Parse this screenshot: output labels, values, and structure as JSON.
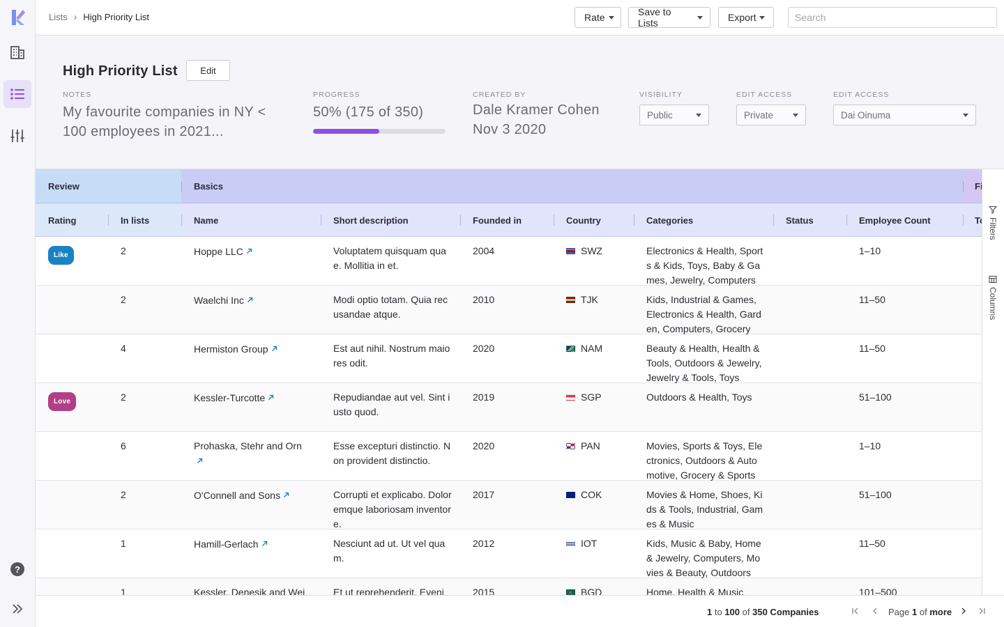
{
  "breadcrumb": {
    "parent": "Lists",
    "current": "High Priority List"
  },
  "toolbar": {
    "rate": "Rate",
    "save_to_lists": "Save to Lists",
    "export": "Export",
    "search_placeholder": "Search"
  },
  "header": {
    "title": "High Priority List",
    "edit_label": "Edit",
    "notes_label": "NOTES",
    "notes_text": "My favourite companies in NY < 100 employees in 2021...",
    "progress_label": "PROGRESS",
    "progress_text": "50% (175 of 350)",
    "progress_fraction": 0.5,
    "created_by_label": "CREATED BY",
    "created_by_name": "Dale Kramer Cohen",
    "created_date": "Nov 3 2020",
    "visibility_label": "VISIBILITY",
    "visibility_value": "Public",
    "edit_access_label_1": "EDIT ACCESS",
    "edit_access_value_1": "Private",
    "edit_access_label_2": "EDIT ACCESS",
    "edit_access_value_2": "Dai Oinuma"
  },
  "table": {
    "groups": {
      "review": "Review",
      "basics": "Basics",
      "third": "Fi"
    },
    "columns": {
      "rating": "Rating",
      "in_lists": "In lists",
      "name": "Name",
      "short_description": "Short description",
      "founded_in": "Founded in",
      "country": "Country",
      "categories": "Categories",
      "status": "Status",
      "employee_count": "Employee Count",
      "next": "To"
    },
    "rows": [
      {
        "rating": "Like",
        "in_lists": "2",
        "name": "Hoppe LLC",
        "description": "Voluptatem quisquam quae. Mollitia in et.",
        "founded": "2004",
        "country": "SWZ",
        "categories": "Electronics & Health, Sports & Kids, Toys, Baby & Games, Jewelry, Computers",
        "employees": "1–10"
      },
      {
        "rating": "",
        "in_lists": "2",
        "name": "Waelchi Inc",
        "description": "Modi optio totam. Quia recusandae atque.",
        "founded": "2010",
        "country": "TJK",
        "categories": "Kids, Industrial & Games, Electronics & Health, Garden, Computers, Grocery",
        "employees": "11–50"
      },
      {
        "rating": "",
        "in_lists": "4",
        "name": "Hermiston Group",
        "description": "Est aut nihil. Nostrum maiores odit.",
        "founded": "2020",
        "country": "NAM",
        "categories": "Beauty & Health, Health & Tools, Outdoors & Jewelry, Jewelry & Tools, Toys",
        "employees": "11–50"
      },
      {
        "rating": "Love",
        "in_lists": "2",
        "name": "Kessler-Turcotte",
        "description": "Repudiandae aut vel. Sint iusto quod.",
        "founded": "2019",
        "country": "SGP",
        "categories": "Outdoors & Health, Toys",
        "employees": "51–100"
      },
      {
        "rating": "",
        "in_lists": "6",
        "name": "Prohaska, Stehr and Orn",
        "description": "Esse excepturi distinctio. Non provident distinctio.",
        "founded": "2020",
        "country": "PAN",
        "categories": "Movies, Sports & Toys, Electronics, Outdoors & Automotive, Grocery & Sports",
        "employees": "1–10"
      },
      {
        "rating": "",
        "in_lists": "2",
        "name": "O'Connell and Sons",
        "description": "Corrupti et explicabo. Doloremque laboriosam inventore.",
        "founded": "2017",
        "country": "COK",
        "categories": "Movies & Home, Shoes, Kids & Tools, Industrial, Games & Music",
        "employees": "51–100"
      },
      {
        "rating": "",
        "in_lists": "1",
        "name": "Hamill-Gerlach",
        "description": "Nesciunt ad ut. Ut vel quam.",
        "founded": "2012",
        "country": "IOT",
        "categories": "Kids, Music & Baby, Home & Jewelry, Computers, Movies & Beauty, Outdoors",
        "employees": "11–50"
      },
      {
        "rating": "",
        "in_lists": "1",
        "name": "Kessler, Denesik and Wei",
        "description": "Et ut reprehenderit. Eveni",
        "founded": "2015",
        "country": "BGD",
        "categories": "Home, Health & Music",
        "employees": "101–500"
      }
    ]
  },
  "side_panel": {
    "filters": "Filters",
    "columns": "Columns"
  },
  "footer": {
    "range_start": "1",
    "to": "to",
    "range_end": "100",
    "of": "of",
    "total": "350 Companies",
    "page_word": "Page",
    "page_number": "1",
    "page_of": "of",
    "page_more": "more"
  },
  "colors": {
    "accent": "#8d4fe0",
    "like_badge": "#1a82c4",
    "love_badge": "#b23f86"
  }
}
